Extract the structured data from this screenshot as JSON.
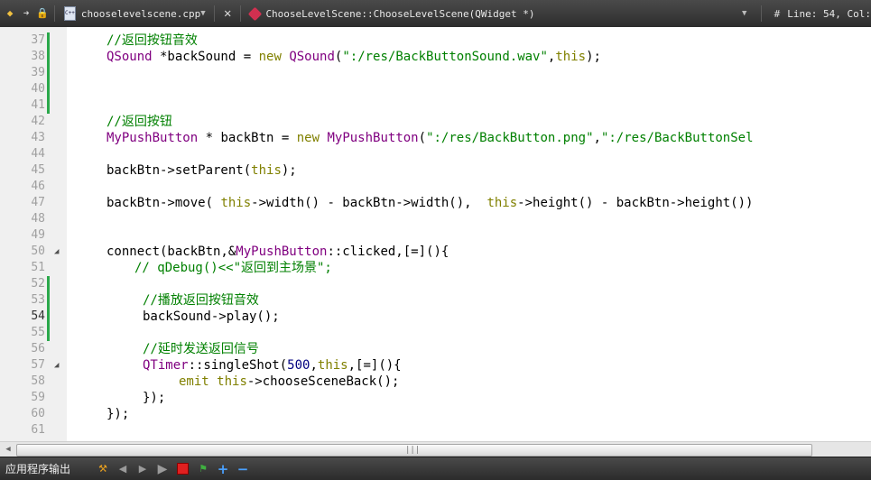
{
  "toolbar": {
    "file_name": "chooselevelscene.cpp",
    "file_icon_text": "C++",
    "function_name": "ChooseLevelScene::ChooseLevelScene(QWidget *)",
    "hash": "#",
    "cursor_position": "Line: 54, Col:"
  },
  "output_bar": {
    "title": "应用程序输出"
  },
  "colors": {
    "comment": "#008000",
    "keyword": "#808000",
    "type": "#800080",
    "string": "#008000",
    "change_marker": "#2aa84a"
  },
  "lines": [
    {
      "num": "37",
      "segments": [
        {
          "cls": "c-comment",
          "text": "//返回按钮音效"
        }
      ],
      "indent": 0
    },
    {
      "num": "38",
      "segments": [
        {
          "cls": "c-type",
          "text": "QSound"
        },
        {
          "cls": "",
          "text": " *backSound = "
        },
        {
          "cls": "c-kw",
          "text": "new"
        },
        {
          "cls": "",
          "text": " "
        },
        {
          "cls": "c-type",
          "text": "QSound"
        },
        {
          "cls": "",
          "text": "("
        },
        {
          "cls": "c-str",
          "text": "\":/res/BackButtonSound.wav\""
        },
        {
          "cls": "",
          "text": ","
        },
        {
          "cls": "c-kw",
          "text": "this"
        },
        {
          "cls": "",
          "text": ");"
        }
      ],
      "indent": 0
    },
    {
      "num": "39",
      "segments": [],
      "indent": 0
    },
    {
      "num": "40",
      "segments": [],
      "indent": 0
    },
    {
      "num": "41",
      "segments": [],
      "indent": 0
    },
    {
      "num": "42",
      "segments": [
        {
          "cls": "c-comment",
          "text": "//返回按钮"
        }
      ],
      "indent": 0
    },
    {
      "num": "43",
      "segments": [
        {
          "cls": "c-type",
          "text": "MyPushButton"
        },
        {
          "cls": "",
          "text": " * backBtn = "
        },
        {
          "cls": "c-kw",
          "text": "new"
        },
        {
          "cls": "",
          "text": " "
        },
        {
          "cls": "c-type",
          "text": "MyPushButton"
        },
        {
          "cls": "",
          "text": "("
        },
        {
          "cls": "c-str",
          "text": "\":/res/BackButton.png\""
        },
        {
          "cls": "",
          "text": ","
        },
        {
          "cls": "c-str",
          "text": "\":/res/BackButtonSel"
        }
      ],
      "indent": 0
    },
    {
      "num": "44",
      "segments": [],
      "indent": 0
    },
    {
      "num": "45",
      "segments": [
        {
          "cls": "",
          "text": "backBtn->setParent("
        },
        {
          "cls": "c-kw",
          "text": "this"
        },
        {
          "cls": "",
          "text": ");"
        }
      ],
      "indent": 0
    },
    {
      "num": "46",
      "segments": [],
      "indent": 0
    },
    {
      "num": "47",
      "segments": [
        {
          "cls": "",
          "text": "backBtn->move( "
        },
        {
          "cls": "c-kw",
          "text": "this"
        },
        {
          "cls": "",
          "text": "->width() - backBtn->width(),  "
        },
        {
          "cls": "c-kw",
          "text": "this"
        },
        {
          "cls": "",
          "text": "->height() - backBtn->height())"
        }
      ],
      "indent": 0
    },
    {
      "num": "48",
      "segments": [],
      "indent": 0
    },
    {
      "num": "49",
      "segments": [],
      "indent": 0
    },
    {
      "num": "50",
      "segments": [
        {
          "cls": "",
          "text": "connect(backBtn,&"
        },
        {
          "cls": "c-type",
          "text": "MyPushButton"
        },
        {
          "cls": "",
          "text": "::clicked,[=](){"
        }
      ],
      "indent": 0
    },
    {
      "num": "51",
      "segments": [
        {
          "cls": "c-comment",
          "text": "// qDebug()<<\"返回到主场景\";"
        }
      ],
      "indent": 1
    },
    {
      "num": "52",
      "segments": [],
      "indent": 0
    },
    {
      "num": "53",
      "segments": [
        {
          "cls": "c-comment",
          "text": "//播放返回按钮音效"
        }
      ],
      "indent": 2
    },
    {
      "num": "54",
      "segments": [
        {
          "cls": "",
          "text": "backSound->play();"
        }
      ],
      "indent": 2
    },
    {
      "num": "55",
      "segments": [],
      "indent": 0
    },
    {
      "num": "56",
      "segments": [
        {
          "cls": "c-comment",
          "text": "//延时发送返回信号"
        }
      ],
      "indent": 2
    },
    {
      "num": "57",
      "segments": [
        {
          "cls": "c-type",
          "text": "QTimer"
        },
        {
          "cls": "",
          "text": "::singleShot("
        },
        {
          "cls": "c-fn",
          "text": "500"
        },
        {
          "cls": "",
          "text": ","
        },
        {
          "cls": "c-kw",
          "text": "this"
        },
        {
          "cls": "",
          "text": ",[=](){"
        }
      ],
      "indent": 2
    },
    {
      "num": "58",
      "segments": [
        {
          "cls": "c-kw",
          "text": "emit"
        },
        {
          "cls": "",
          "text": " "
        },
        {
          "cls": "c-kw",
          "text": "this"
        },
        {
          "cls": "",
          "text": "->chooseSceneBack();"
        }
      ],
      "indent": 3
    },
    {
      "num": "59",
      "segments": [
        {
          "cls": "",
          "text": "});"
        }
      ],
      "indent": 2
    },
    {
      "num": "60",
      "segments": [
        {
          "cls": "",
          "text": "});"
        }
      ],
      "indent": 0
    },
    {
      "num": "61",
      "segments": [],
      "indent": 0
    }
  ],
  "current_line": "54",
  "fold_lines": [
    "50",
    "57"
  ],
  "changed_lines": [
    "37",
    "38",
    "39",
    "40",
    "41",
    "52",
    "53",
    "54",
    "55"
  ]
}
